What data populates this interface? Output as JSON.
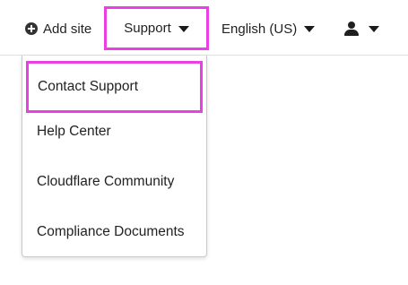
{
  "header": {
    "add_site_label": "Add site",
    "support_label": "Support",
    "language_label": "English (US)",
    "icons": {
      "add": "plus-circle-icon",
      "caret": "caret-down-icon",
      "user": "user-icon"
    }
  },
  "support_menu": {
    "items": [
      {
        "label": "Contact Support"
      },
      {
        "label": "Help Center"
      },
      {
        "label": "Cloudflare Community"
      },
      {
        "label": "Compliance Documents"
      }
    ]
  },
  "colors": {
    "highlight": "#e940e3",
    "text": "#222222",
    "border": "#c9c9c9"
  }
}
